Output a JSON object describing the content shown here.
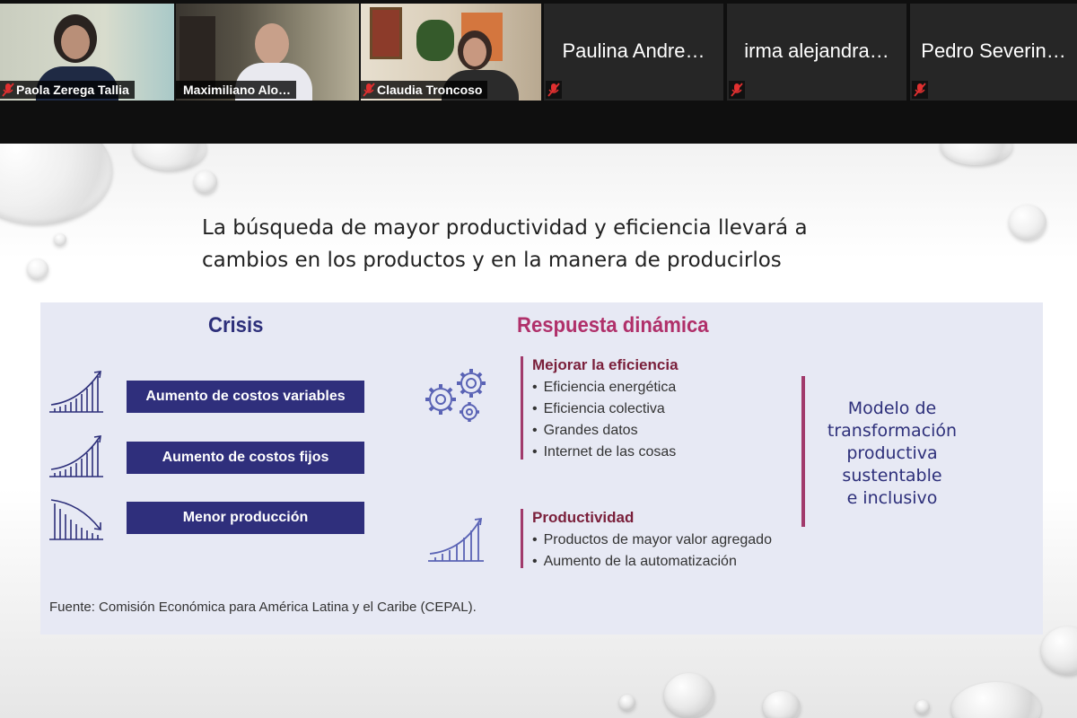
{
  "participants": [
    {
      "name": "Paola Zerega Tallia",
      "muted": true,
      "video": true
    },
    {
      "name": "Maximiliano Alo…",
      "muted": false,
      "video": true,
      "active": true
    },
    {
      "name": "Claudia Troncoso",
      "muted": true,
      "video": true
    },
    {
      "name": "Paulina Andre…",
      "muted": true,
      "video": false
    },
    {
      "name": "irma alejandra…",
      "muted": true,
      "video": false
    },
    {
      "name": "Pedro Severin…",
      "muted": true,
      "video": false
    }
  ],
  "slide": {
    "title_line1": "La búsqueda de mayor productividad y eficiencia llevará a",
    "title_line2": "cambios en los productos y en la manera de producirlos",
    "crisis_heading": "Crisis",
    "response_heading": "Respuesta dinámica",
    "crisis_items": [
      "Aumento de costos variables",
      "Aumento de costos fijos",
      "Menor producción"
    ],
    "efficiency": {
      "title": "Mejorar la eficiencia",
      "items": [
        "Eficiencia energética",
        "Eficiencia colectiva",
        "Grandes datos",
        "Internet de las cosas"
      ]
    },
    "productivity": {
      "title": "Productividad",
      "items": [
        "Productos de mayor valor agregado",
        "Aumento de la automatización"
      ]
    },
    "model_lines": [
      "Modelo de",
      "transformación",
      "productiva",
      "sustentable",
      "e inclusivo"
    ],
    "source": "Fuente: Comisión Económica para América Latina y el Caribe (CEPAL)."
  },
  "colors": {
    "navy": "#2f2f7c",
    "magenta": "#b0306a",
    "maroon": "#7a1f3a",
    "panel": "#e7e9f4",
    "active_speaker_border": "#c9d94a",
    "muted_icon": "#e03030"
  }
}
